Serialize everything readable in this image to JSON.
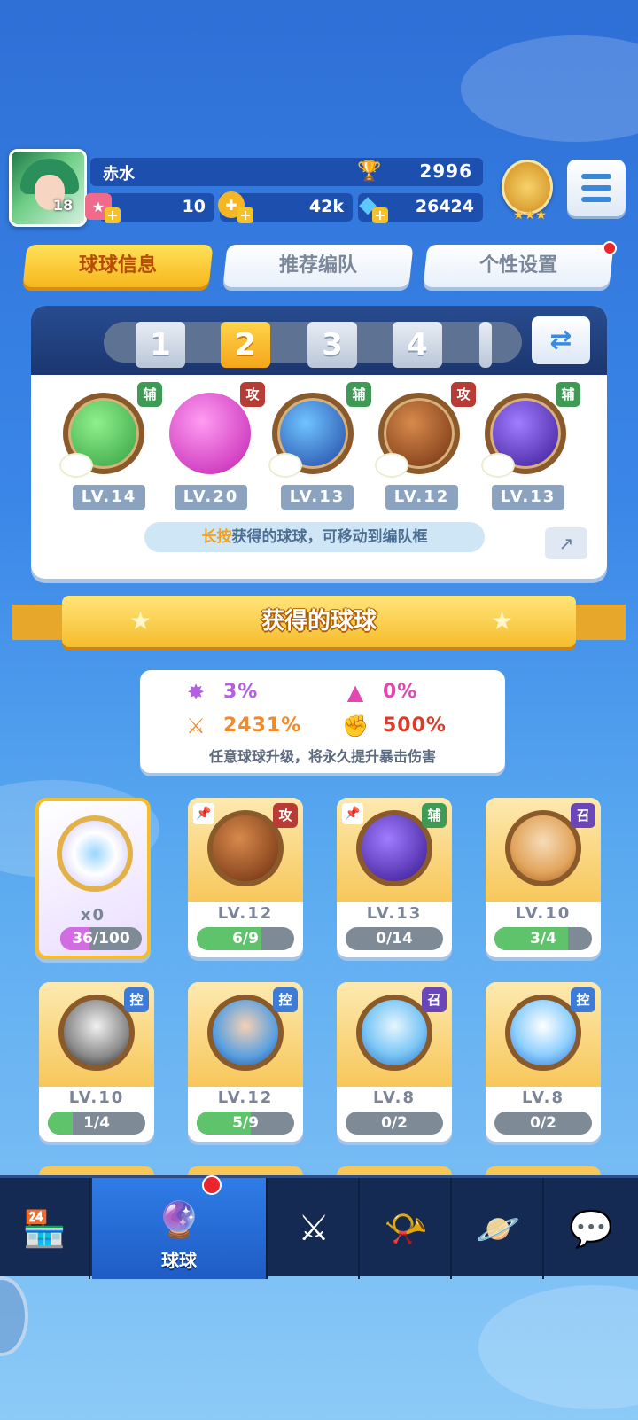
{
  "player": {
    "name": "赤水",
    "level": "18",
    "trophies": "2996",
    "tickets": "10",
    "coins": "42k",
    "gems": "26424"
  },
  "tabs": [
    {
      "label": "球球信息",
      "active": true
    },
    {
      "label": "推荐编队",
      "active": false
    },
    {
      "label": "个性设置",
      "active": false,
      "badge": true
    }
  ],
  "team": {
    "slots": [
      "1",
      "2",
      "3",
      "4"
    ],
    "selected_slot": "2",
    "balls": [
      {
        "type": "辅",
        "level": "LV.14",
        "icon": "green-arrow-ball"
      },
      {
        "type": "攻",
        "level": "LV.20",
        "icon": "pink-shield-ball"
      },
      {
        "type": "辅",
        "level": "LV.13",
        "icon": "blue-hex-ball"
      },
      {
        "type": "攻",
        "level": "LV.12",
        "icon": "brown-infinity-ball"
      },
      {
        "type": "辅",
        "level": "LV.13",
        "icon": "purple-lightning-ball"
      }
    ],
    "hint_highlight": "长按",
    "hint_text": "获得的球球，可移动到编队框"
  },
  "section_title": "获得的球球",
  "stats": {
    "crit_rate": "3%",
    "crit_resist": "0%",
    "crit_damage": "2431%",
    "crit_bonus": "500%",
    "note": "任意球球升级，将永久提升暴击伤害"
  },
  "collection": [
    {
      "kind": "special",
      "count": "x0",
      "progress": "36/100",
      "fraction": 0.36
    },
    {
      "type": "攻",
      "level": "LV.12",
      "progress": "6/9",
      "fraction": 0.667,
      "pinned": true,
      "icon": "brown-infinity-ball"
    },
    {
      "type": "辅",
      "level": "LV.13",
      "progress": "0/14",
      "fraction": 0,
      "pinned": true,
      "icon": "purple-lightning-ball"
    },
    {
      "type": "召",
      "level": "LV.10",
      "progress": "3/4",
      "fraction": 0.75,
      "icon": "blond-hero-ball"
    },
    {
      "type": "控",
      "level": "LV.10",
      "progress": "1/4",
      "fraction": 0.25,
      "icon": "white-hair-hero-ball"
    },
    {
      "type": "控",
      "level": "LV.12",
      "progress": "5/9",
      "fraction": 0.556,
      "icon": "blue-hero-ball"
    },
    {
      "type": "召",
      "level": "LV.8",
      "progress": "0/2",
      "fraction": 0,
      "icon": "ice-flower-ball"
    },
    {
      "type": "控",
      "level": "LV.8",
      "progress": "0/2",
      "fraction": 0,
      "icon": "magic-hat-ball"
    }
  ],
  "nav": [
    {
      "label": "",
      "icon": "shop-icon"
    },
    {
      "label": "球球",
      "icon": "ball-icon",
      "active": true,
      "badge": true
    },
    {
      "label": "",
      "icon": "battle-swords-icon"
    },
    {
      "label": "",
      "icon": "whistle-icon"
    },
    {
      "label": "",
      "icon": "planet-icon"
    },
    {
      "label": "",
      "icon": "chat-heart-icon"
    }
  ],
  "colors": {
    "accent": "#f6b71c",
    "fu": "#3e9a55",
    "gong": "#b73c35",
    "zhao": "#6a46b9",
    "kong": "#3c7bd6",
    "progress": "#5ec36a"
  }
}
